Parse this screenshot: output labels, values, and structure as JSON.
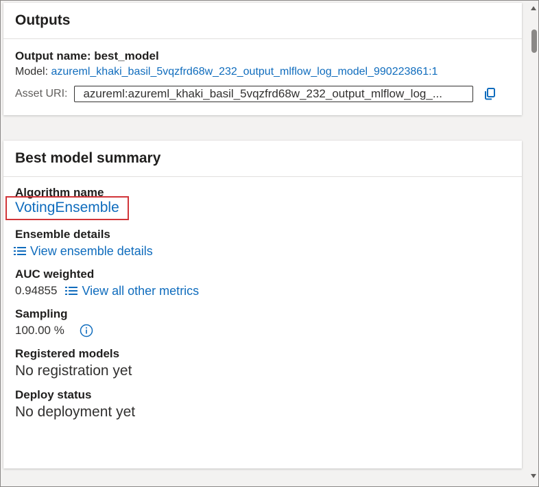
{
  "outputs": {
    "title": "Outputs",
    "output_name_label": "Output name: best_model",
    "model_label": "Model:",
    "model_link": "azureml_khaki_basil_5vqzfrd68w_232_output_mlflow_log_model_990223861:1",
    "asset_uri_label": "Asset URI:",
    "asset_uri_value": "azureml:azureml_khaki_basil_5vqzfrd68w_232_output_mlflow_log_..."
  },
  "summary": {
    "title": "Best model summary",
    "algorithm_label": "Algorithm name",
    "algorithm_value": "VotingEnsemble",
    "ensemble_label": "Ensemble details",
    "ensemble_link": "View ensemble details",
    "auc_label": "AUC weighted",
    "auc_value": "0.94855",
    "metrics_link": "View all other metrics",
    "sampling_label": "Sampling",
    "sampling_value": "100.00 %",
    "registered_label": "Registered models",
    "registered_value": "No registration yet",
    "deploy_label": "Deploy status",
    "deploy_value": "No deployment yet"
  },
  "icons": {
    "copy": "copy-icon",
    "list": "list-icon",
    "info": "info-icon"
  },
  "colors": {
    "link": "#0f6cbd",
    "highlight": "#d13438"
  }
}
